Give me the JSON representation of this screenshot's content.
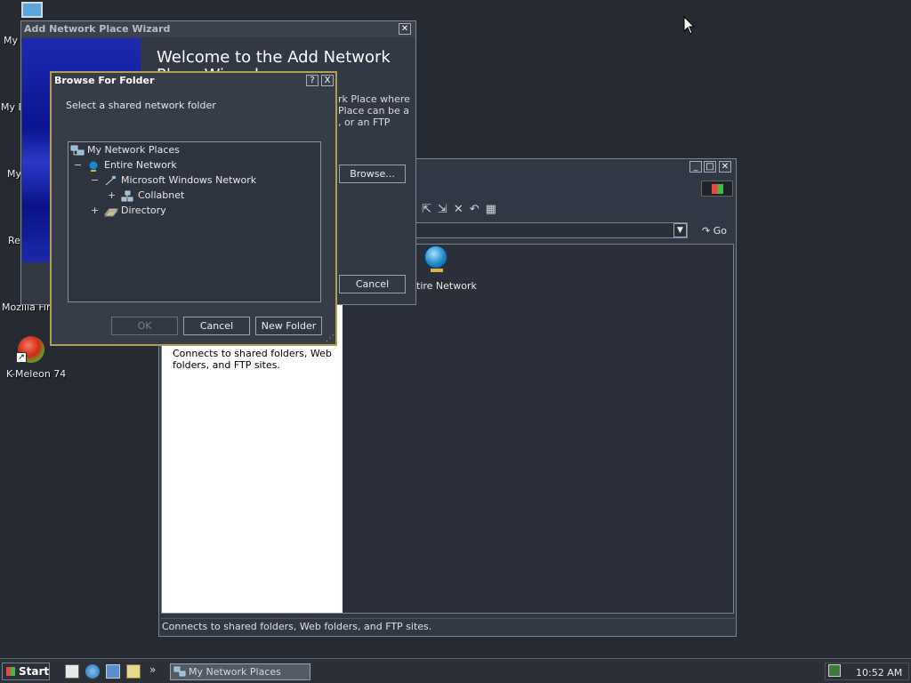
{
  "desktop": {
    "icons": [
      {
        "label": "My",
        "name": "my-computer-label"
      },
      {
        "label": "My D",
        "name": "my-documents-label"
      },
      {
        "label": "My",
        "name": "my-network-label"
      },
      {
        "label": "Re",
        "name": "recycle-bin-label"
      },
      {
        "label": "Mozilla Fire",
        "name": "mozilla-firefox-label"
      },
      {
        "label": "K-Meleon 74",
        "name": "k-meleon-label"
      }
    ]
  },
  "explorer": {
    "go_label": "Go",
    "item_label": "Entire Network",
    "item_label_visible": "tire Network",
    "left_pane_text": "Connects to shared folders, Web folders, and FTP sites.",
    "status_text": "Connects to shared folders, Web folders, and FTP sites."
  },
  "wizard": {
    "title": "Add Network Place Wizard",
    "heading_line1": "Welcome to the Add Network",
    "heading_line2": "Place Wizard",
    "desc_line1": "rk Place where",
    "desc_line2": "Place can be a",
    "desc_line3": ", or an FTP",
    "browse_label": "Browse...",
    "cancel_label": "Cancel"
  },
  "browse_dialog": {
    "title": "Browse For Folder",
    "help_label": "?",
    "close_label": "X",
    "prompt": "Select a shared network folder",
    "tree": [
      {
        "label": "My Network Places",
        "expander": "",
        "icon": "network-places-icon"
      },
      {
        "label": "Entire Network",
        "expander": "−",
        "icon": "globe-icon"
      },
      {
        "label": "Microsoft Windows Network",
        "expander": "−",
        "icon": "windows-network-icon"
      },
      {
        "label": "Collabnet",
        "expander": "+",
        "icon": "workgroup-icon"
      },
      {
        "label": "Directory",
        "expander": "+",
        "icon": "directory-icon"
      }
    ],
    "ok_label": "OK",
    "cancel_label": "Cancel",
    "new_folder_label": "New Folder"
  },
  "taskbar": {
    "start_label": "Start",
    "task_label": "My Network Places",
    "clock": "10:52 AM",
    "more_label": "»"
  },
  "colors": {
    "desktop": "#252a33",
    "window_bg": "#313744",
    "dialog_border": "#b0a04c",
    "accent_globe": "#1e88c9"
  }
}
